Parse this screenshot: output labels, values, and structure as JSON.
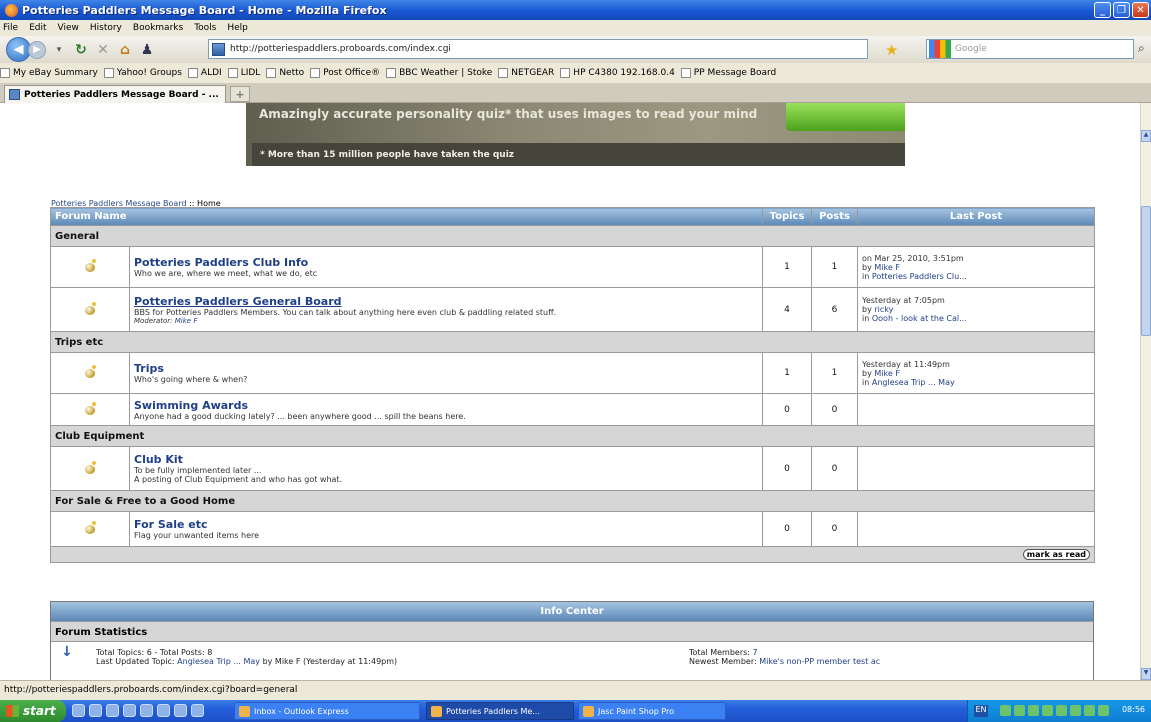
{
  "window": {
    "title": "Potteries Paddlers Message Board - Home - Mozilla Firefox"
  },
  "menu": [
    "File",
    "Edit",
    "View",
    "History",
    "Bookmarks",
    "Tools",
    "Help"
  ],
  "nav": {
    "url": "http://potteriespaddlers.proboards.com/index.cgi",
    "search_placeholder": "Google"
  },
  "bookmarks": [
    "My eBay Summary",
    "Yahoo! Groups",
    "ALDI",
    "LIDL",
    "Netto",
    "Post Office®",
    "BBC Weather | Stoke",
    "NETGEAR",
    "HP C4380 192.168.0.4",
    "PP Message Board"
  ],
  "tab": {
    "label": "Potteries Paddlers Message Board - ..."
  },
  "ad": {
    "headline": "Amazingly accurate personality quiz* that uses images to read your mind",
    "note": "* More than 15 million people have taken the quiz"
  },
  "breadcrumb": {
    "board": "Potteries Paddlers Message Board",
    "sep": " :: ",
    "current": "Home"
  },
  "table": {
    "headers": {
      "forum": "Forum Name",
      "topics": "Topics",
      "posts": "Posts",
      "last": "Last Post"
    },
    "categories": [
      {
        "name": "General",
        "forums": [
          {
            "title": "Potteries Paddlers Club Info",
            "desc": "Who we are, where we meet, what we do, etc",
            "topics": "1",
            "posts": "1",
            "last1": "on Mar 25, 2010, 3:51pm",
            "last_by": "Mike F",
            "last_in": "Potteries Paddlers Clu..."
          },
          {
            "title": "Potteries Paddlers General Board",
            "desc": "BBS for Potteries Paddlers Members. You can talk about anything here even club & paddling related stuff.",
            "mod_label": "Moderator:",
            "mod": "Mike F",
            "topics": "4",
            "posts": "6",
            "last1": "Yesterday at 7:05pm",
            "last_by": "ricky",
            "last_in": "Oooh - look at the Cal..."
          }
        ]
      },
      {
        "name": "Trips etc",
        "forums": [
          {
            "title": "Trips",
            "desc": "Who's going where & when?",
            "topics": "1",
            "posts": "1",
            "last1": "Yesterday at 11:49pm",
            "last_by": "Mike F",
            "last_in": "Anglesea Trip ... May"
          },
          {
            "title": "Swimming Awards",
            "desc": "Anyone had a good ducking lately? ... been anywhere good ... spill the beans here.",
            "topics": "0",
            "posts": "0"
          }
        ]
      },
      {
        "name": "Club Equipment",
        "forums": [
          {
            "title": "Club Kit",
            "desc": "To be fully implemented later ...",
            "desc2": "A posting of Club Equipment and who has got what.",
            "topics": "0",
            "posts": "0"
          }
        ]
      },
      {
        "name": "For Sale & Free to a Good Home",
        "forums": [
          {
            "title": "For Sale etc",
            "desc": "Flag your unwanted items here",
            "topics": "0",
            "posts": "0"
          }
        ]
      }
    ],
    "mark_read": "mark as read",
    "by": "by",
    "in": "in"
  },
  "info": {
    "header": "Info Center",
    "section": "Forum Statistics",
    "left1": "Total Topics: 6  -  Total Posts: 8",
    "left2_label": "Last Updated Topic:",
    "left2_link": "Anglesea Trip ... May",
    "left2_tail": "by Mike F (Yesterday at 11:49pm)",
    "right1_label": "Total Members:",
    "right1_val": "7",
    "right2_label": "Newest Member:",
    "right2_val": "Mike's non-PP member test ac"
  },
  "status": "http://potteriespaddlers.proboards.com/index.cgi?board=general",
  "taskbar": {
    "start": "start",
    "tasks": [
      "Inbox - Outlook Express",
      "Potteries Paddlers Me...",
      "Jasc Paint Shop Pro"
    ],
    "lang": "EN",
    "clock": "08:56"
  }
}
